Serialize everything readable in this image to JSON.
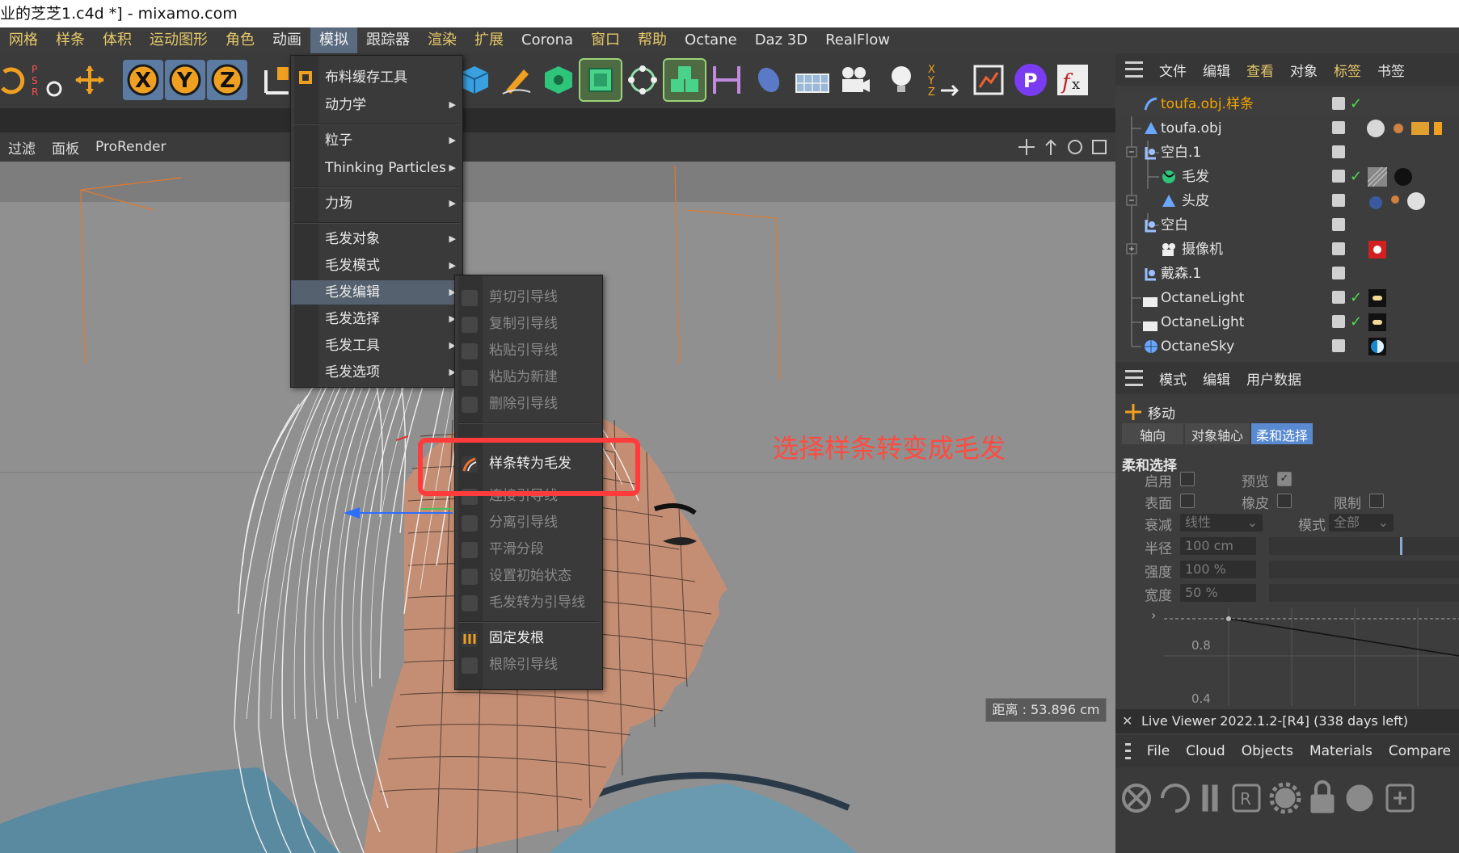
{
  "window": {
    "title": "业的芝芝1.c4d *] - mixamo.com"
  },
  "menubar": {
    "items": [
      "网格",
      "样条",
      "体积",
      "运动图形",
      "角色",
      "动画",
      "模拟",
      "跟踪器",
      "渲染",
      "扩展",
      "Corona",
      "窗口",
      "帮助",
      "Octane",
      "Daz 3D",
      "RealFlow"
    ],
    "active": "模拟"
  },
  "viewport_menu": {
    "items": [
      "过滤",
      "面板",
      "ProRender"
    ]
  },
  "simulate_menu": {
    "items": [
      {
        "label": "布料缓存工具",
        "arrow": false
      },
      {
        "label": "动力学",
        "arrow": true
      },
      {
        "label": "粒子",
        "arrow": true
      },
      {
        "label": "Thinking Particles",
        "arrow": true
      },
      {
        "label": "力场",
        "arrow": true
      },
      {
        "label": "毛发对象",
        "arrow": true
      },
      {
        "label": "毛发模式",
        "arrow": true
      },
      {
        "label": "毛发编辑",
        "arrow": true
      },
      {
        "label": "毛发选择",
        "arrow": true
      },
      {
        "label": "毛发工具",
        "arrow": true
      },
      {
        "label": "毛发选项",
        "arrow": true
      }
    ],
    "highlighted": "毛发编辑"
  },
  "hair_edit_submenu": {
    "items": [
      {
        "label": "剪切引导线",
        "enabled": false
      },
      {
        "label": "复制引导线",
        "enabled": false
      },
      {
        "label": "粘贴引导线",
        "enabled": false
      },
      {
        "label": "粘贴为新建",
        "enabled": false
      },
      {
        "label": "删除引导线",
        "enabled": false
      },
      {
        "label": "样条转为毛发",
        "enabled": true
      },
      {
        "label": "连接引导线",
        "enabled": false
      },
      {
        "label": "分离引导线",
        "enabled": false
      },
      {
        "label": "平滑分段",
        "enabled": false
      },
      {
        "label": "设置初始状态",
        "enabled": false
      },
      {
        "label": "毛发转为引导线",
        "enabled": false
      },
      {
        "label": "固定发根",
        "enabled": true
      },
      {
        "label": "根除引导线",
        "enabled": false
      }
    ]
  },
  "annotation": {
    "text": "选择样条转变成毛发",
    "color": "#ff4b40"
  },
  "viewport": {
    "distance_label": "距离 : 53.896 cm"
  },
  "object_manager": {
    "menu": [
      "文件",
      "编辑",
      "查看",
      "对象",
      "标签",
      "书签"
    ],
    "objects": [
      {
        "name": "toufa.obj.样条",
        "selected": true
      },
      {
        "name": "toufa.obj",
        "selected": false
      },
      {
        "name": "空白.1",
        "selected": false
      },
      {
        "name": "毛发",
        "selected": false
      },
      {
        "name": "头皮",
        "selected": false
      },
      {
        "name": "空白",
        "selected": false
      },
      {
        "name": "摄像机",
        "selected": false
      },
      {
        "name": "戴森.1",
        "selected": false
      },
      {
        "name": "OctaneLight",
        "selected": false
      },
      {
        "name": "OctaneLight",
        "selected": false
      },
      {
        "name": "OctaneSky",
        "selected": false
      }
    ]
  },
  "attribute_manager": {
    "menu": [
      "模式",
      "编辑",
      "用户数据"
    ],
    "tool_name": "移动",
    "tabs": [
      "轴向",
      "对象轴心",
      "柔和选择"
    ],
    "active_tab": "柔和选择",
    "section": "柔和选择",
    "fields": {
      "enable": "启用",
      "preview": "预览",
      "surface": "表面",
      "rubber": "橡皮",
      "limit": "限制",
      "falloff": "衰减",
      "falloff_value": "线性",
      "mode": "模式",
      "mode_value": "全部",
      "radius": "半径",
      "radius_value": "100 cm",
      "strength": "强度",
      "strength_value": "100 %",
      "width": "宽度",
      "width_value": "50 %"
    },
    "graph_ticks": [
      "0.8",
      "0.4"
    ]
  },
  "live_viewer": {
    "title": "Live Viewer 2022.1.2-[R4] (338 days left)",
    "menu": [
      "File",
      "Cloud",
      "Objects",
      "Materials",
      "Compare"
    ]
  }
}
